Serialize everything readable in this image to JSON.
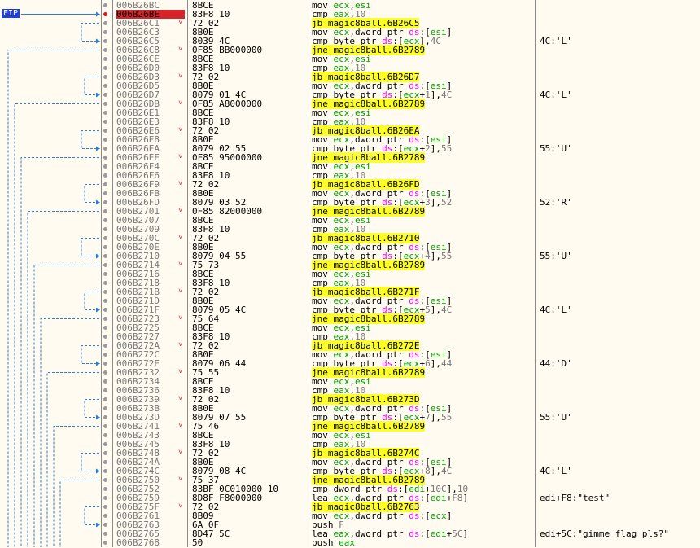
{
  "eip_label": "EIP",
  "colors": {
    "current_address_bg": "#d7242a",
    "jump_highlight": "#ffff28",
    "register": "#00a000",
    "segment": "#ff00ff",
    "number": "#767676",
    "arrow": "#2a7fd8"
  },
  "rows": [
    {
      "addr": "006B26BC",
      "bytes": "8BCE",
      "mn": "mov",
      "ops": "ecx,esi",
      "cmt": ""
    },
    {
      "addr": "006B26BE",
      "bytes": "83F8 10",
      "mn": "cmp",
      "ops": "eax,10",
      "cmt": "",
      "current": true
    },
    {
      "addr": "006B26C1",
      "bytes": "72 02",
      "mn": "jb",
      "ops": "magic8ball.6B26C5",
      "cmt": "",
      "jump": true,
      "mark": true
    },
    {
      "addr": "006B26C3",
      "bytes": "8B0E",
      "mn": "mov",
      "ops": "ecx,dword ptr ds:[esi]",
      "cmt": ""
    },
    {
      "addr": "006B26C5",
      "bytes": "8039 4C",
      "mn": "cmp",
      "ops": "byte ptr ds:[ecx],4C",
      "cmt": "4C:'L'"
    },
    {
      "addr": "006B26C8",
      "bytes": "0F85 BB000000",
      "mn": "jne",
      "ops": "magic8ball.6B2789",
      "cmt": "",
      "jump": true,
      "mark": true
    },
    {
      "addr": "006B26CE",
      "bytes": "8BCE",
      "mn": "mov",
      "ops": "ecx,esi",
      "cmt": ""
    },
    {
      "addr": "006B26D0",
      "bytes": "83F8 10",
      "mn": "cmp",
      "ops": "eax,10",
      "cmt": ""
    },
    {
      "addr": "006B26D3",
      "bytes": "72 02",
      "mn": "jb",
      "ops": "magic8ball.6B26D7",
      "cmt": "",
      "jump": true,
      "mark": true
    },
    {
      "addr": "006B26D5",
      "bytes": "8B0E",
      "mn": "mov",
      "ops": "ecx,dword ptr ds:[esi]",
      "cmt": ""
    },
    {
      "addr": "006B26D7",
      "bytes": "8079 01 4C",
      "mn": "cmp",
      "ops": "byte ptr ds:[ecx+1],4C",
      "cmt": "4C:'L'"
    },
    {
      "addr": "006B26DB",
      "bytes": "0F85 A8000000",
      "mn": "jne",
      "ops": "magic8ball.6B2789",
      "cmt": "",
      "jump": true,
      "mark": true
    },
    {
      "addr": "006B26E1",
      "bytes": "8BCE",
      "mn": "mov",
      "ops": "ecx,esi",
      "cmt": ""
    },
    {
      "addr": "006B26E3",
      "bytes": "83F8 10",
      "mn": "cmp",
      "ops": "eax,10",
      "cmt": ""
    },
    {
      "addr": "006B26E6",
      "bytes": "72 02",
      "mn": "jb",
      "ops": "magic8ball.6B26EA",
      "cmt": "",
      "jump": true,
      "mark": true
    },
    {
      "addr": "006B26E8",
      "bytes": "8B0E",
      "mn": "mov",
      "ops": "ecx,dword ptr ds:[esi]",
      "cmt": ""
    },
    {
      "addr": "006B26EA",
      "bytes": "8079 02 55",
      "mn": "cmp",
      "ops": "byte ptr ds:[ecx+2],55",
      "cmt": "55:'U'"
    },
    {
      "addr": "006B26EE",
      "bytes": "0F85 95000000",
      "mn": "jne",
      "ops": "magic8ball.6B2789",
      "cmt": "",
      "jump": true,
      "mark": true
    },
    {
      "addr": "006B26F4",
      "bytes": "8BCE",
      "mn": "mov",
      "ops": "ecx,esi",
      "cmt": ""
    },
    {
      "addr": "006B26F6",
      "bytes": "83F8 10",
      "mn": "cmp",
      "ops": "eax,10",
      "cmt": ""
    },
    {
      "addr": "006B26F9",
      "bytes": "72 02",
      "mn": "jb",
      "ops": "magic8ball.6B26FD",
      "cmt": "",
      "jump": true,
      "mark": true
    },
    {
      "addr": "006B26FB",
      "bytes": "8B0E",
      "mn": "mov",
      "ops": "ecx,dword ptr ds:[esi]",
      "cmt": ""
    },
    {
      "addr": "006B26FD",
      "bytes": "8079 03 52",
      "mn": "cmp",
      "ops": "byte ptr ds:[ecx+3],52",
      "cmt": "52:'R'"
    },
    {
      "addr": "006B2701",
      "bytes": "0F85 82000000",
      "mn": "jne",
      "ops": "magic8ball.6B2789",
      "cmt": "",
      "jump": true,
      "mark": true
    },
    {
      "addr": "006B2707",
      "bytes": "8BCE",
      "mn": "mov",
      "ops": "ecx,esi",
      "cmt": ""
    },
    {
      "addr": "006B2709",
      "bytes": "83F8 10",
      "mn": "cmp",
      "ops": "eax,10",
      "cmt": ""
    },
    {
      "addr": "006B270C",
      "bytes": "72 02",
      "mn": "jb",
      "ops": "magic8ball.6B2710",
      "cmt": "",
      "jump": true,
      "mark": true
    },
    {
      "addr": "006B270E",
      "bytes": "8B0E",
      "mn": "mov",
      "ops": "ecx,dword ptr ds:[esi]",
      "cmt": ""
    },
    {
      "addr": "006B2710",
      "bytes": "8079 04 55",
      "mn": "cmp",
      "ops": "byte ptr ds:[ecx+4],55",
      "cmt": "55:'U'"
    },
    {
      "addr": "006B2714",
      "bytes": "75 73",
      "mn": "jne",
      "ops": "magic8ball.6B2789",
      "cmt": "",
      "jump": true,
      "mark": true
    },
    {
      "addr": "006B2716",
      "bytes": "8BCE",
      "mn": "mov",
      "ops": "ecx,esi",
      "cmt": ""
    },
    {
      "addr": "006B2718",
      "bytes": "83F8 10",
      "mn": "cmp",
      "ops": "eax,10",
      "cmt": ""
    },
    {
      "addr": "006B271B",
      "bytes": "72 02",
      "mn": "jb",
      "ops": "magic8ball.6B271F",
      "cmt": "",
      "jump": true,
      "mark": true
    },
    {
      "addr": "006B271D",
      "bytes": "8B0E",
      "mn": "mov",
      "ops": "ecx,dword ptr ds:[esi]",
      "cmt": ""
    },
    {
      "addr": "006B271F",
      "bytes": "8079 05 4C",
      "mn": "cmp",
      "ops": "byte ptr ds:[ecx+5],4C",
      "cmt": "4C:'L'"
    },
    {
      "addr": "006B2723",
      "bytes": "75 64",
      "mn": "jne",
      "ops": "magic8ball.6B2789",
      "cmt": "",
      "jump": true,
      "mark": true
    },
    {
      "addr": "006B2725",
      "bytes": "8BCE",
      "mn": "mov",
      "ops": "ecx,esi",
      "cmt": ""
    },
    {
      "addr": "006B2727",
      "bytes": "83F8 10",
      "mn": "cmp",
      "ops": "eax,10",
      "cmt": ""
    },
    {
      "addr": "006B272A",
      "bytes": "72 02",
      "mn": "jb",
      "ops": "magic8ball.6B272E",
      "cmt": "",
      "jump": true,
      "mark": true
    },
    {
      "addr": "006B272C",
      "bytes": "8B0E",
      "mn": "mov",
      "ops": "ecx,dword ptr ds:[esi]",
      "cmt": ""
    },
    {
      "addr": "006B272E",
      "bytes": "8079 06 44",
      "mn": "cmp",
      "ops": "byte ptr ds:[ecx+6],44",
      "cmt": "44:'D'"
    },
    {
      "addr": "006B2732",
      "bytes": "75 55",
      "mn": "jne",
      "ops": "magic8ball.6B2789",
      "cmt": "",
      "jump": true,
      "mark": true
    },
    {
      "addr": "006B2734",
      "bytes": "8BCE",
      "mn": "mov",
      "ops": "ecx,esi",
      "cmt": ""
    },
    {
      "addr": "006B2736",
      "bytes": "83F8 10",
      "mn": "cmp",
      "ops": "eax,10",
      "cmt": ""
    },
    {
      "addr": "006B2739",
      "bytes": "72 02",
      "mn": "jb",
      "ops": "magic8ball.6B273D",
      "cmt": "",
      "jump": true,
      "mark": true
    },
    {
      "addr": "006B273B",
      "bytes": "8B0E",
      "mn": "mov",
      "ops": "ecx,dword ptr ds:[esi]",
      "cmt": ""
    },
    {
      "addr": "006B273D",
      "bytes": "8079 07 55",
      "mn": "cmp",
      "ops": "byte ptr ds:[ecx+7],55",
      "cmt": "55:'U'"
    },
    {
      "addr": "006B2741",
      "bytes": "75 46",
      "mn": "jne",
      "ops": "magic8ball.6B2789",
      "cmt": "",
      "jump": true,
      "mark": true
    },
    {
      "addr": "006B2743",
      "bytes": "8BCE",
      "mn": "mov",
      "ops": "ecx,esi",
      "cmt": ""
    },
    {
      "addr": "006B2745",
      "bytes": "83F8 10",
      "mn": "cmp",
      "ops": "eax,10",
      "cmt": ""
    },
    {
      "addr": "006B2748",
      "bytes": "72 02",
      "mn": "jb",
      "ops": "magic8ball.6B274C",
      "cmt": "",
      "jump": true,
      "mark": true
    },
    {
      "addr": "006B274A",
      "bytes": "8B0E",
      "mn": "mov",
      "ops": "ecx,dword ptr ds:[esi]",
      "cmt": ""
    },
    {
      "addr": "006B274C",
      "bytes": "8079 08 4C",
      "mn": "cmp",
      "ops": "byte ptr ds:[ecx+8],4C",
      "cmt": "4C:'L'"
    },
    {
      "addr": "006B2750",
      "bytes": "75 37",
      "mn": "jne",
      "ops": "magic8ball.6B2789",
      "cmt": "",
      "jump": true,
      "mark": true
    },
    {
      "addr": "006B2752",
      "bytes": "83BF 0C010000 10",
      "mn": "cmp",
      "ops": "dword ptr ds:[edi+10C],10",
      "cmt": ""
    },
    {
      "addr": "006B2759",
      "bytes": "8D8F F8000000",
      "mn": "lea",
      "ops": "ecx,dword ptr ds:[edi+F8]",
      "cmt": "edi+F8:\"test\""
    },
    {
      "addr": "006B275F",
      "bytes": "72 02",
      "mn": "jb",
      "ops": "magic8ball.6B2763",
      "cmt": "",
      "jump": true,
      "mark": true
    },
    {
      "addr": "006B2761",
      "bytes": "8B09",
      "mn": "mov",
      "ops": "ecx,dword ptr ds:[ecx]",
      "cmt": ""
    },
    {
      "addr": "006B2763",
      "bytes": "6A 0F",
      "mn": "push",
      "ops": "F",
      "cmt": ""
    },
    {
      "addr": "006B2765",
      "bytes": "8D47 5C",
      "mn": "lea",
      "ops": "eax,dword ptr ds:[edi+5C]",
      "cmt": "edi+5C:\"gimme flag pls?\""
    },
    {
      "addr": "006B2768",
      "bytes": "50",
      "mn": "push",
      "ops": "eax",
      "cmt": ""
    }
  ]
}
